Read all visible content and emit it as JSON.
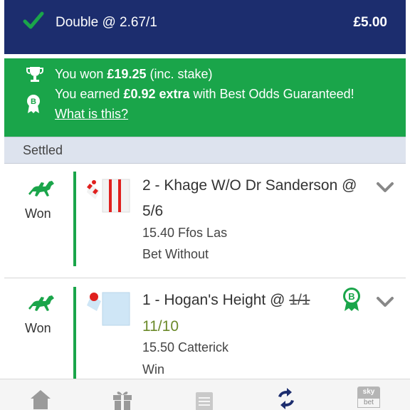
{
  "header": {
    "title": "Double @ 2.67/1",
    "amount": "£5.00",
    "icon": "checkmark-icon",
    "color": "#1c2d6e"
  },
  "win_banner": {
    "color": "#1aa54a",
    "line1_prefix": "You won ",
    "line1_amount": "£19.25",
    "line1_suffix": " (inc. stake)",
    "line2_prefix": "You earned ",
    "line2_amount": "£0.92 extra",
    "line2_suffix": " with Best Odds Guaranteed!",
    "link": "What is this?"
  },
  "section": {
    "label": "Settled"
  },
  "bets": [
    {
      "status": "Won",
      "selection": "2 - Khage W/O Dr Sanderson @",
      "price": "5/6",
      "race": "15.40 Ffos Las",
      "market": "Bet Without"
    },
    {
      "status": "Won",
      "selection": "1 - Hogan's Height @ ",
      "original_price": "1/1",
      "price": "11/10",
      "race": "15.50 Catterick",
      "market": "Win"
    }
  ],
  "tabs": [
    "home-icon",
    "gift-icon",
    "betslip-icon",
    "my-bets-icon",
    "skybet-logo-icon"
  ],
  "logo_text": {
    "top": "sky",
    "bottom": "bet"
  }
}
